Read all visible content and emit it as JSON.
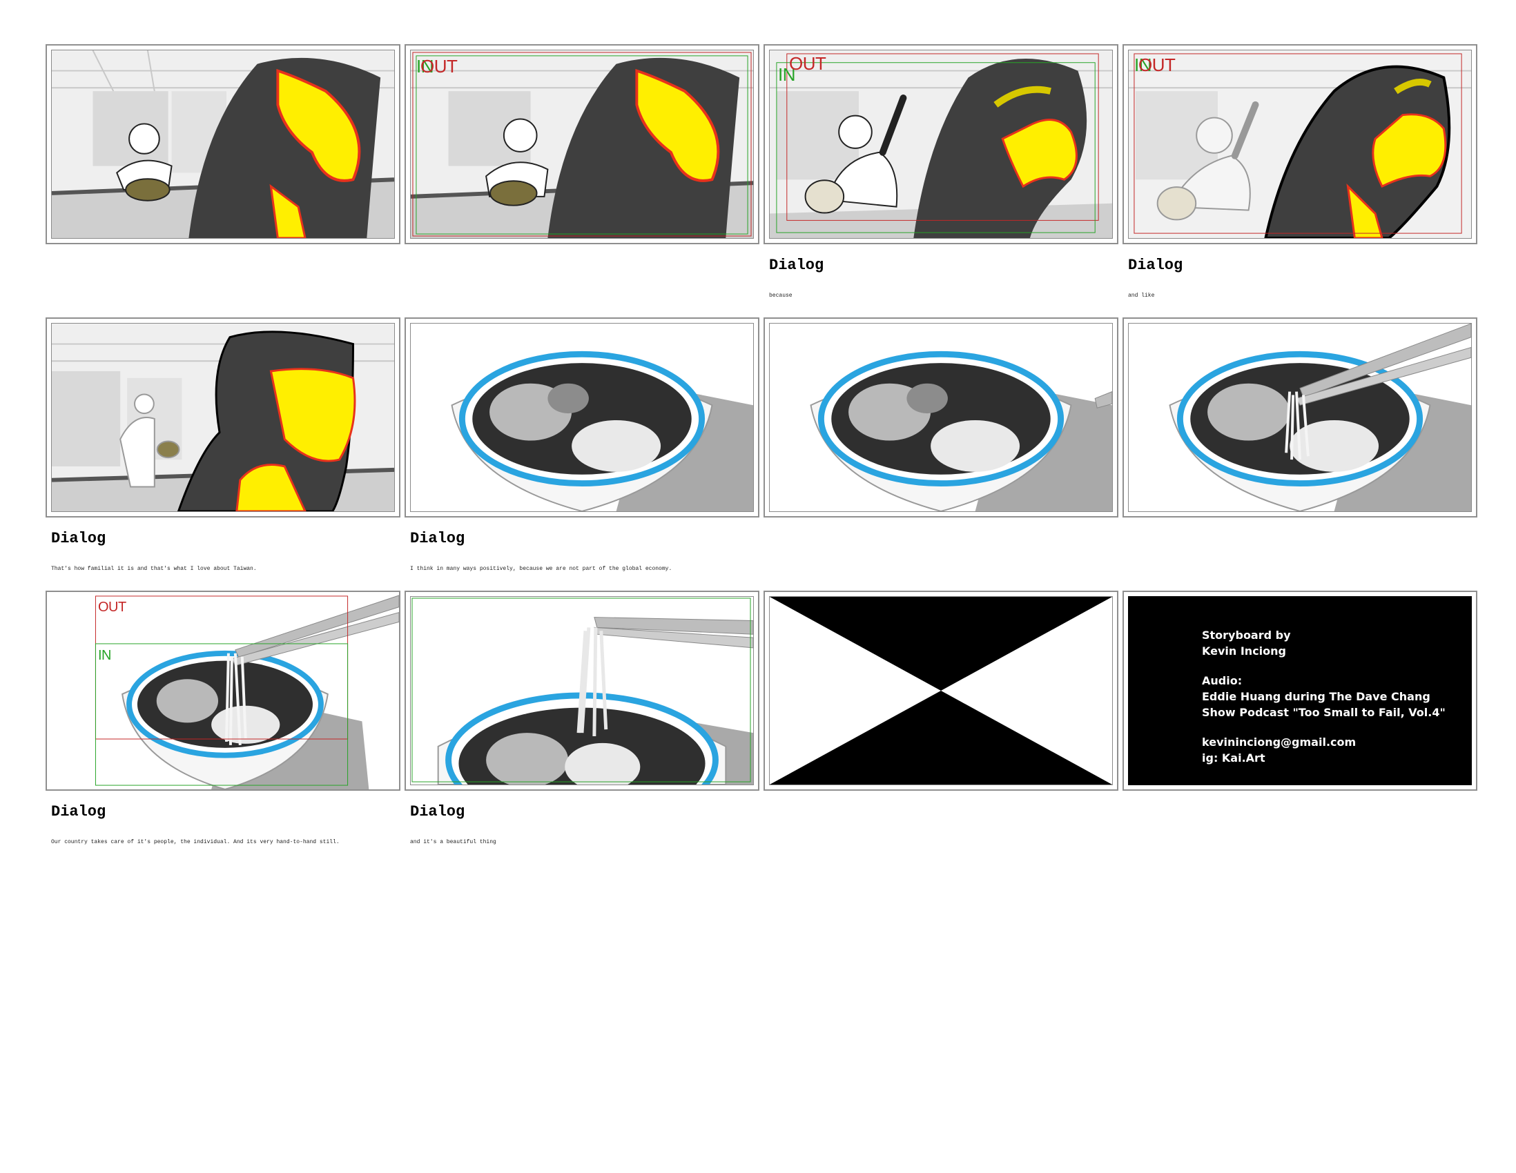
{
  "panels": [
    {
      "id": 1,
      "tags": {
        "out": "",
        "in": ""
      },
      "dialog_heading": "",
      "dialog": ""
    },
    {
      "id": 2,
      "tags": {
        "out": "OUT",
        "in": "IN"
      },
      "dialog_heading": "",
      "dialog": ""
    },
    {
      "id": 3,
      "tags": {
        "out": "OUT",
        "in": "IN"
      },
      "dialog_heading": "Dialog",
      "dialog": "because"
    },
    {
      "id": 4,
      "tags": {
        "out": "OUT",
        "in": "IN"
      },
      "dialog_heading": "Dialog",
      "dialog": "and like"
    },
    {
      "id": 5,
      "tags": {
        "out": "",
        "in": ""
      },
      "dialog_heading": "Dialog",
      "dialog": "That's how familial it is and that's what I love about Taiwan."
    },
    {
      "id": 6,
      "tags": {
        "out": "",
        "in": ""
      },
      "dialog_heading": "Dialog",
      "dialog": "I think in many ways positively, because we are not part of the global economy."
    },
    {
      "id": 7,
      "tags": {
        "out": "",
        "in": ""
      },
      "dialog_heading": "",
      "dialog": ""
    },
    {
      "id": 8,
      "tags": {
        "out": "",
        "in": ""
      },
      "dialog_heading": "",
      "dialog": ""
    },
    {
      "id": 9,
      "tags": {
        "out": "OUT",
        "in": "IN"
      },
      "dialog_heading": "Dialog",
      "dialog": "Our country takes care of it's people, the individual. And its very hand-to-hand still."
    },
    {
      "id": 10,
      "tags": {
        "out": "",
        "in": ""
      },
      "dialog_heading": "Dialog",
      "dialog": "and it's a beautiful thing"
    },
    {
      "id": 11,
      "tags": {
        "out": "",
        "in": ""
      },
      "dialog_heading": "",
      "dialog": ""
    },
    {
      "id": 12,
      "tags": {
        "out": "",
        "in": ""
      },
      "dialog_heading": "",
      "dialog": ""
    }
  ],
  "credits": {
    "line1": "Storyboard by",
    "line2": "Kevin Inciong",
    "line3": "Audio:",
    "line4": "Eddie Huang during The Dave Chang",
    "line5": "Show Podcast \"Too Small to Fail, Vol.4\"",
    "line6": "kevininciong@gmail.com",
    "line7": "ig: Kai.Art"
  },
  "colors": {
    "out_frame": "#c42727",
    "in_frame": "#27a427",
    "highlight_yellow": "#ffef00",
    "highlight_red": "#e8321b",
    "bowl_rim_blue": "#2aa4e0"
  }
}
